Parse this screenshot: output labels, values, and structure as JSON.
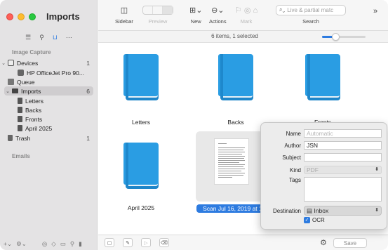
{
  "window": {
    "title": "Imports"
  },
  "sidebar": {
    "sections": [
      {
        "title": "Image Capture"
      },
      {
        "title": "Emails"
      }
    ],
    "items": [
      {
        "label": "Devices",
        "count": "1"
      },
      {
        "label": "HP OfficeJet Pro 90..."
      },
      {
        "label": "Queue"
      },
      {
        "label": "Imports",
        "count": "6"
      },
      {
        "label": "Letters"
      },
      {
        "label": "Backs"
      },
      {
        "label": "Fronts"
      },
      {
        "label": "April 2025"
      },
      {
        "label": "Trash",
        "count": "1"
      }
    ]
  },
  "toolbar": {
    "sidebar_label": "Sidebar",
    "preview_label": "Preview",
    "new_label": "New",
    "actions_label": "Actions",
    "mark_label": "Mark",
    "search_label": "Search",
    "search_placeholder": "Live & partial matc",
    "more": "»"
  },
  "status": {
    "text": "6 items, 1 selected",
    "zoom_fraction": 0.3
  },
  "grid": {
    "items": [
      {
        "label": "Letters"
      },
      {
        "label": "Backs"
      },
      {
        "label": "Fronts"
      },
      {
        "label": "April 2025"
      },
      {
        "label": "Scan Jul 16, 2019 at 10:"
      }
    ]
  },
  "bottombar": {
    "save_label": "Save"
  },
  "popover": {
    "name_label": "Name",
    "name_placeholder": "Automatic",
    "author_label": "Author",
    "author_value": "JSN",
    "subject_label": "Subject",
    "subject_value": "",
    "kind_label": "Kind",
    "kind_value": "PDF",
    "tags_label": "Tags",
    "destination_label": "Destination",
    "destination_value": "Inbox",
    "ocr_label": "OCR",
    "ocr_checked": true
  },
  "colors": {
    "accent": "#2d7be0",
    "book": "#2a9de3"
  }
}
